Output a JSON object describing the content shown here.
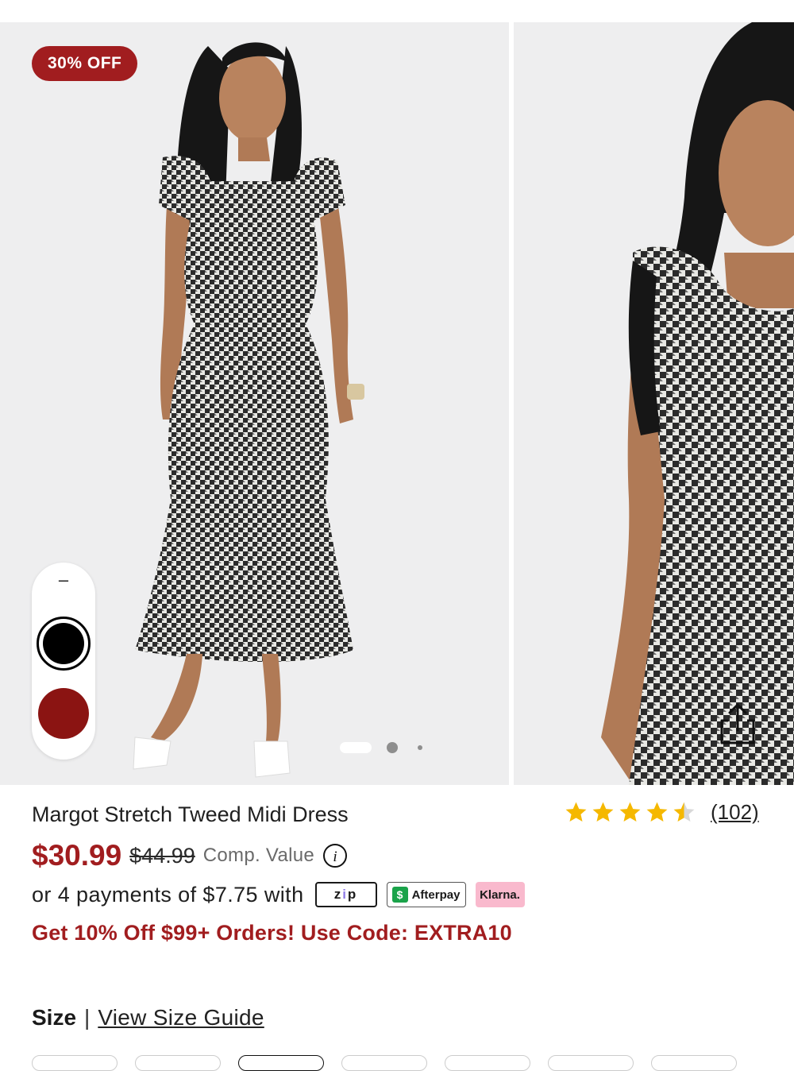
{
  "gallery": {
    "badge": "30% OFF",
    "collapse_glyph": "–",
    "swatches": [
      {
        "name": "black",
        "color": "#000000",
        "selected": true
      },
      {
        "name": "red",
        "color": "#8b1412",
        "selected": false
      }
    ],
    "current_slide": 1,
    "slide_count": 3
  },
  "product": {
    "title": "Margot Stretch Tweed Midi Dress",
    "rating": 4.5,
    "review_count": "(102)",
    "price": "$30.99",
    "original_price": "$44.99",
    "comp_value": "Comp. Value",
    "payments_text": "or 4 payments of $7.75 with",
    "zip_label": [
      "z",
      "i",
      "p"
    ],
    "afterpay_label": "Afterpay",
    "afterpay_icon": "$",
    "klarna_label": "Klarna.",
    "promo": "Get 10% Off $99+ Orders! Use Code: EXTRA10"
  },
  "size": {
    "label": "Size",
    "separator": "|",
    "guide_link": "View Size Guide"
  },
  "colors": {
    "accent": "#a11d1f",
    "star": "#f5b800"
  }
}
